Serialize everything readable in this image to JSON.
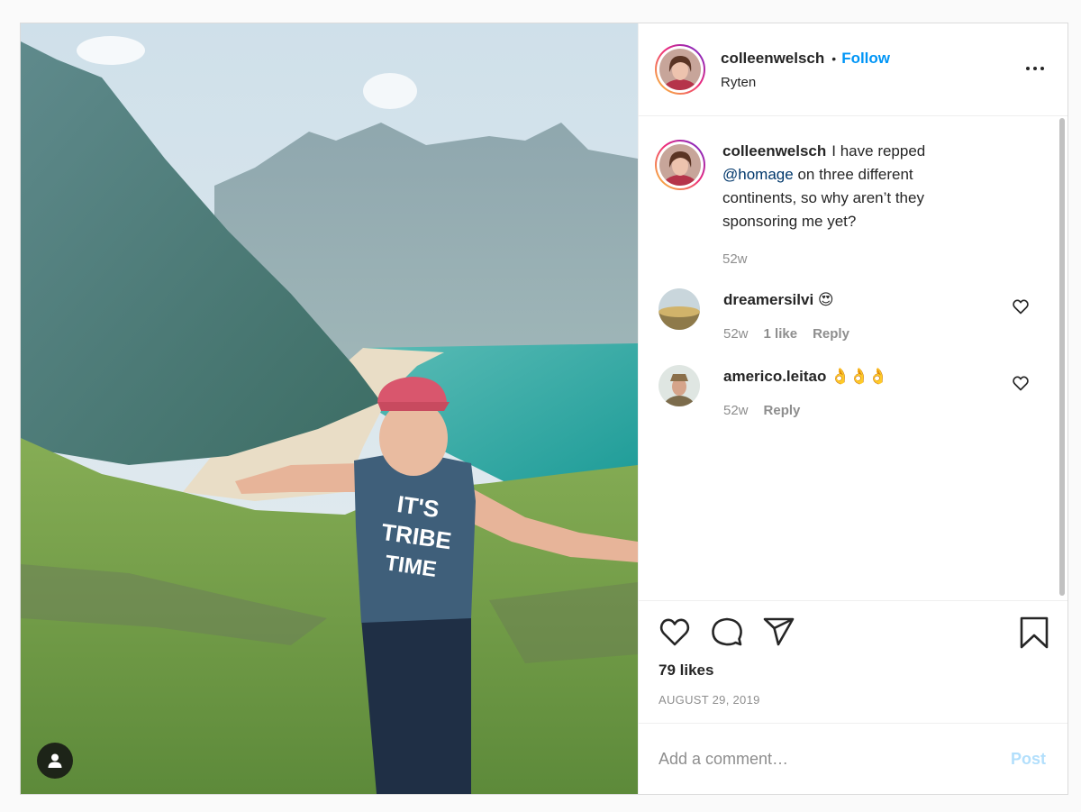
{
  "author": {
    "username": "colleenwelsch",
    "follow_label": "Follow",
    "separator": "•",
    "location": "Ryten"
  },
  "caption": {
    "username": "colleenwelsch",
    "text_before": "I have repped",
    "mention": "@homage",
    "text_after": "on three different continents, so why aren’t they sponsoring me yet?",
    "age": "52w"
  },
  "comments": [
    {
      "username": "dreamersilvi",
      "text": "😍",
      "age": "52w",
      "likes": "1 like",
      "reply_label": "Reply"
    },
    {
      "username": "americo.leitao",
      "text": "👌👌👌",
      "age": "52w",
      "reply_label": "Reply"
    }
  ],
  "actions": {
    "likes": "79 likes",
    "date": "AUGUST 29, 2019"
  },
  "comment_box": {
    "placeholder": "Add a comment…",
    "post_label": "Post"
  },
  "photo": {
    "shirt_text": [
      "IT'S",
      "TRIBE",
      "TIME"
    ]
  },
  "colors": {
    "link_blue": "#0095f6",
    "mention_blue": "#00376b",
    "secondary": "#8e8e8e",
    "post_disabled": "#b2dffc"
  },
  "icons": [
    "tag-user-icon",
    "more-options-icon",
    "heart-icon",
    "comment-icon",
    "share-icon",
    "bookmark-icon"
  ]
}
